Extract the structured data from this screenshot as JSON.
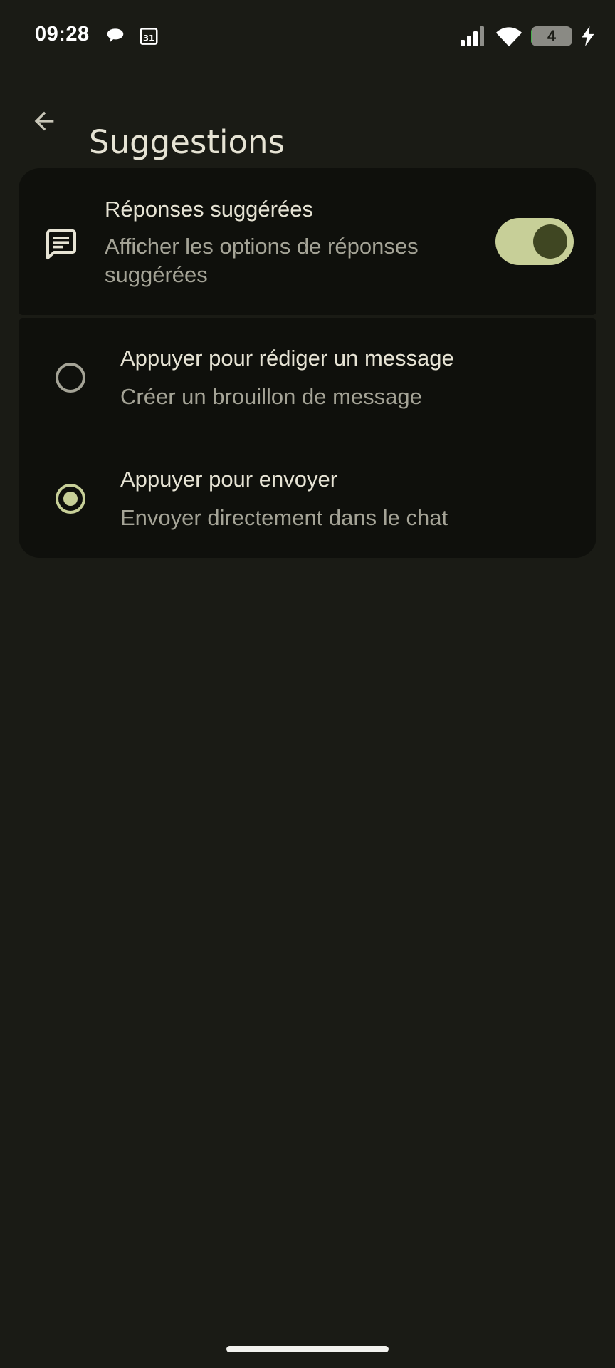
{
  "status_bar": {
    "time": "09:28",
    "battery_level": "4",
    "battery_fraction": 0.04,
    "icons": [
      "chat-bubble-icon",
      "calendar-icon",
      "signal-icon",
      "wifi-icon",
      "battery-icon",
      "charging-bolt-icon"
    ]
  },
  "app_bar": {
    "back_icon": "arrow-back-icon",
    "title": "Suggestions"
  },
  "suggested_replies": {
    "icon": "message-lines-icon",
    "title": "Réponses suggérées",
    "description": "Afficher les options de réponses suggérées",
    "enabled": true
  },
  "tap_behavior": {
    "options": [
      {
        "title": "Appuyer pour rédiger un message",
        "description": "Créer un brouillon de message",
        "selected": false
      },
      {
        "title": "Appuyer pour envoyer",
        "description": "Envoyer directement dans le chat",
        "selected": true
      }
    ]
  },
  "colors": {
    "background": "#1a1b15",
    "card": "#0f100c",
    "accent": "#c7cf98",
    "toggle_knob": "#3f4622",
    "primary_text": "#e6e3d4",
    "secondary_text": "#a4a396"
  }
}
